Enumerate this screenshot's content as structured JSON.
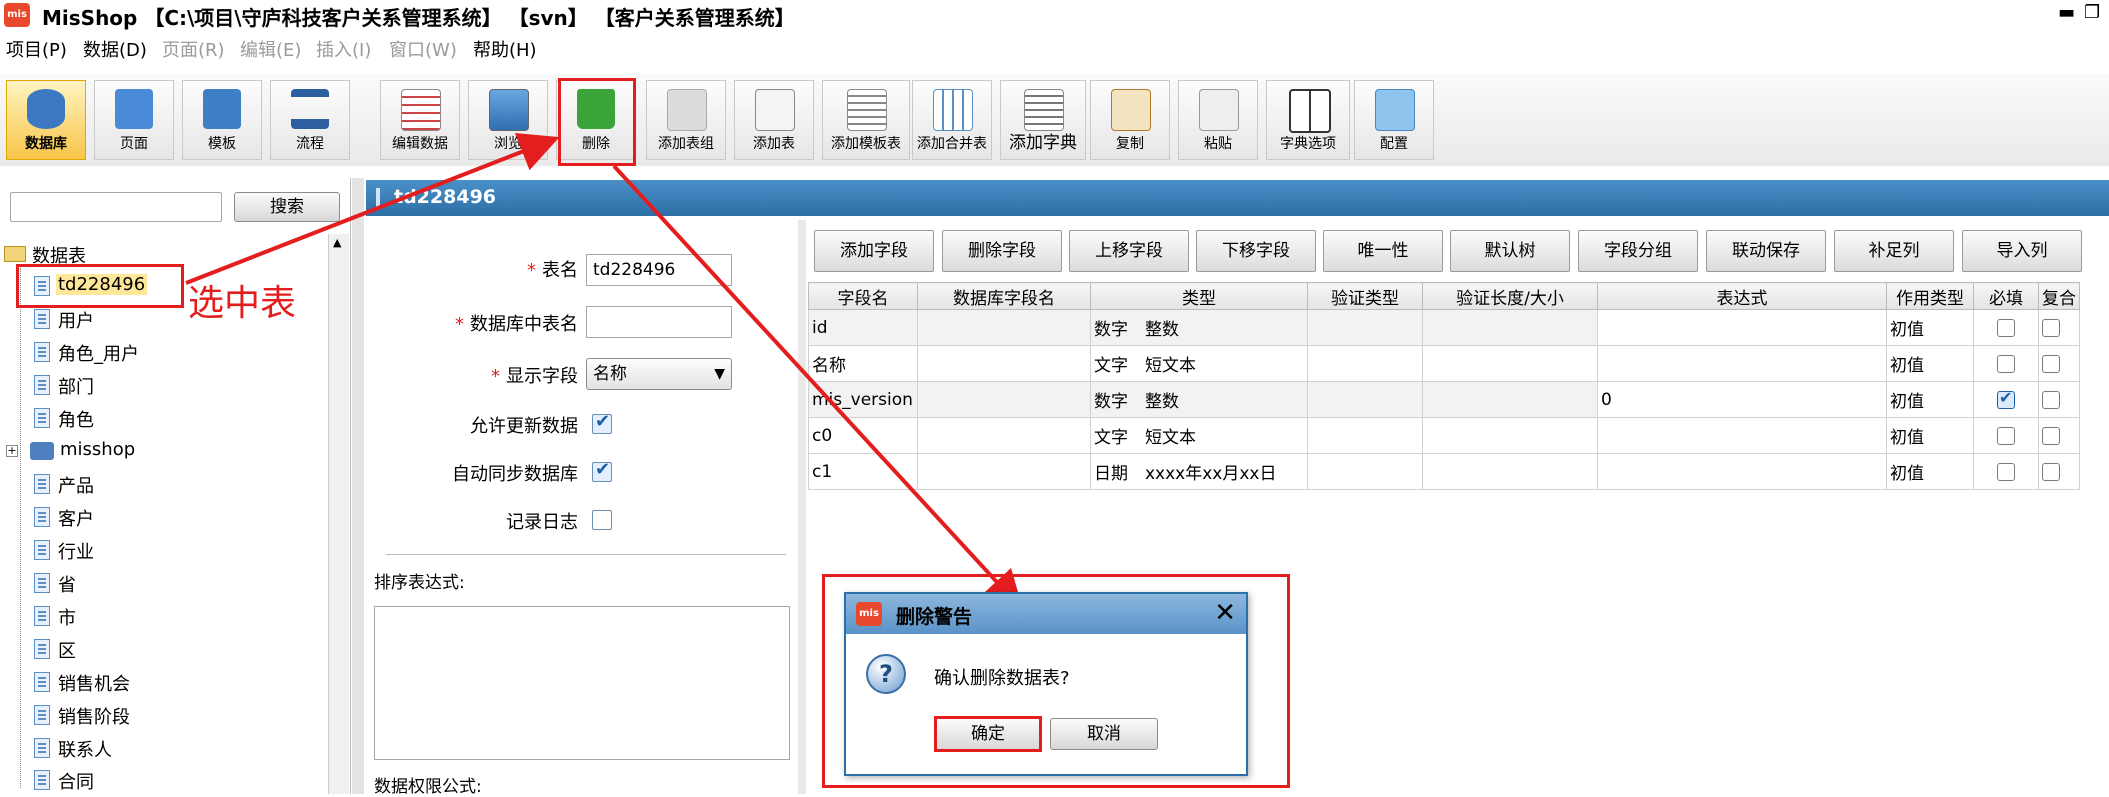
{
  "window": {
    "logo_text": "mis",
    "title": "MisShop 【C:\\项目\\守庐科技客户关系管理系统】 【svn】 【客户关系管理系统】",
    "minimize": "▬",
    "restore": "❐"
  },
  "menu": [
    {
      "label": "项目(P)",
      "enabled": true
    },
    {
      "label": "数据(D)",
      "enabled": true
    },
    {
      "label": "页面(R)",
      "enabled": false
    },
    {
      "label": "编辑(E)",
      "enabled": false
    },
    {
      "label": "插入(I)",
      "enabled": false
    },
    {
      "label": "窗口(W)",
      "enabled": false
    },
    {
      "label": "帮助(H)",
      "enabled": true
    }
  ],
  "toolbar": {
    "modes": [
      {
        "label": "数据库",
        "icon": "database-icon",
        "active": true
      },
      {
        "label": "页面",
        "icon": "page-icon",
        "active": false
      },
      {
        "label": "模板",
        "icon": "template-icon",
        "active": false
      },
      {
        "label": "流程",
        "icon": "flow-icon",
        "active": false
      }
    ],
    "actions": [
      {
        "label": "编辑数据",
        "icon": "edit-data-icon"
      },
      {
        "label": "浏览",
        "icon": "browse-icon"
      },
      {
        "label": "删除",
        "icon": "trash-icon"
      },
      {
        "label": "添加表组",
        "icon": "add-table-group-icon"
      },
      {
        "label": "添加表",
        "icon": "add-table-icon"
      },
      {
        "label": "添加模板表",
        "icon": "add-template-table-icon"
      },
      {
        "label": "添加合并表",
        "icon": "add-merge-table-icon"
      },
      {
        "label": "添加字典",
        "icon": "add-dictionary-icon"
      },
      {
        "label": "复制",
        "icon": "copy-icon"
      },
      {
        "label": "粘贴",
        "icon": "paste-icon"
      },
      {
        "label": "字典选项",
        "icon": "dictionary-options-icon"
      },
      {
        "label": "配置",
        "icon": "config-icon"
      }
    ]
  },
  "left_panel": {
    "search_value": "",
    "search_button": "搜索",
    "tree_root": "数据表",
    "tree_items": [
      {
        "label": "td228496",
        "selected": true,
        "type": "table"
      },
      {
        "label": "用户",
        "type": "table"
      },
      {
        "label": "角色_用户",
        "type": "table"
      },
      {
        "label": "部门",
        "type": "table"
      },
      {
        "label": "角色",
        "type": "table"
      },
      {
        "label": "misshop",
        "type": "group"
      },
      {
        "label": "产品",
        "type": "table"
      },
      {
        "label": "客户",
        "type": "table"
      },
      {
        "label": "行业",
        "type": "table"
      },
      {
        "label": "省",
        "type": "table"
      },
      {
        "label": "市",
        "type": "table"
      },
      {
        "label": "区",
        "type": "table"
      },
      {
        "label": "销售机会",
        "type": "table"
      },
      {
        "label": "销售阶段",
        "type": "table"
      },
      {
        "label": "联系人",
        "type": "table"
      },
      {
        "label": "合同",
        "type": "table"
      }
    ]
  },
  "table_panel": {
    "header_title": "td228496",
    "form": {
      "table_name_label": "表名",
      "table_name_value": "td228496",
      "db_table_label": "数据库中表名",
      "db_table_value": "",
      "display_field_label": "显示字段",
      "display_field_value": "名称",
      "allow_update_label": "允许更新数据",
      "allow_update": true,
      "auto_sync_label": "自动同步数据库",
      "auto_sync": true,
      "log_label": "记录日志",
      "log": false,
      "sort_expr_label": "排序表达式:",
      "data_perm_label": "数据权限公式:"
    },
    "grid_buttons": [
      "添加字段",
      "删除字段",
      "上移字段",
      "下移字段",
      "唯一性",
      "默认树",
      "字段分组",
      "联动保存",
      "补足列",
      "导入列"
    ],
    "columns": [
      "字段名",
      "数据库字段名",
      "类型",
      "验证类型",
      "验证长度/大小",
      "表达式",
      "作用类型",
      "必填",
      "复合"
    ],
    "rows": [
      {
        "name": "id",
        "db_name": "",
        "type": "数字　整数",
        "valid_type": "",
        "valid_len": "",
        "expr": "",
        "role": "初值",
        "required": false
      },
      {
        "name": "名称",
        "db_name": "",
        "type": "文字　短文本",
        "valid_type": "",
        "valid_len": "",
        "expr": "",
        "role": "初值",
        "required": false
      },
      {
        "name": "mis_version",
        "db_name": "",
        "type": "数字　整数",
        "valid_type": "",
        "valid_len": "",
        "expr": "0",
        "role": "初值",
        "required": true
      },
      {
        "name": "c0",
        "db_name": "",
        "type": "文字　短文本",
        "valid_type": "",
        "valid_len": "",
        "expr": "",
        "role": "初值",
        "required": false
      },
      {
        "name": "c1",
        "db_name": "",
        "type": "日期　xxxx年xx月xx日",
        "valid_type": "",
        "valid_len": "",
        "expr": "",
        "role": "初值",
        "required": false
      }
    ]
  },
  "dialog": {
    "logo_text": "mis",
    "title": "删除警告",
    "close": "✕",
    "icon": "question-icon",
    "message": "确认删除数据表?",
    "ok": "确定",
    "cancel": "取消"
  },
  "annotation": {
    "text": "选中表",
    "color": "#e41e1e"
  }
}
